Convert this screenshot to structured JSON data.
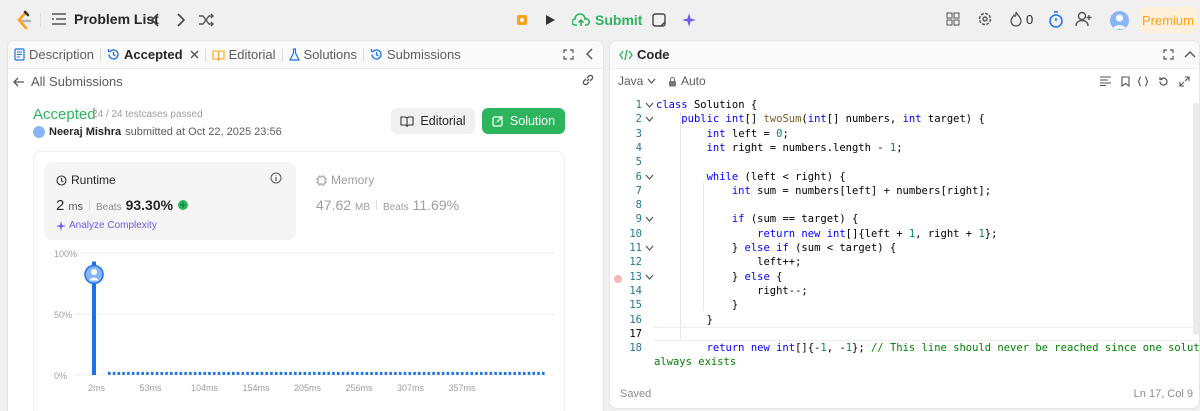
{
  "topbar": {
    "title": "Problem List",
    "submit_label": "Submit",
    "streak_count": "0",
    "premium_label": "Premium"
  },
  "left": {
    "tabs": [
      {
        "label": "Description"
      },
      {
        "label": "Accepted"
      },
      {
        "label": "Editorial"
      },
      {
        "label": "Solutions"
      },
      {
        "label": "Submissions"
      }
    ],
    "back_label": "All Submissions",
    "status": "Accepted",
    "testcases": "24 / 24 testcases passed",
    "user": "Neeraj Mishra",
    "submitted_at": "submitted at Oct 22, 2025 23:56",
    "editorial_btn": "Editorial",
    "solution_btn": "Solution",
    "runtime": {
      "label": "Runtime",
      "value": "2",
      "unit": "ms",
      "beats_label": "Beats",
      "beats": "93.30%"
    },
    "memory": {
      "label": "Memory",
      "value": "47.62",
      "unit": "MB",
      "beats_label": "Beats",
      "beats": "11.69%"
    },
    "analyze_label": "Analyze Complexity"
  },
  "chart_data": {
    "type": "bar",
    "title": "",
    "xlabel": "",
    "ylabel": "",
    "y_ticks": [
      "100%",
      "50%",
      "0%"
    ],
    "x_ticks": [
      "2ms",
      "53ms",
      "104ms",
      "154ms",
      "205ms",
      "256ms",
      "307ms",
      "357ms"
    ],
    "ylim": [
      0,
      100
    ],
    "highlight": {
      "x": "2ms",
      "value": 93
    },
    "baseline_value": 0.5,
    "color": "#1a73e8"
  },
  "right": {
    "title": "Code",
    "language": "Java",
    "mode": "Auto",
    "saved_label": "Saved",
    "cursor": "Ln 17, Col 9",
    "line_numbers": [
      "1",
      "2",
      "3",
      "4",
      "5",
      "6",
      "7",
      "8",
      "9",
      "10",
      "11",
      "12",
      "13",
      "14",
      "15",
      "16",
      "17",
      "18"
    ],
    "last_line_wrap": "always exists"
  },
  "colors": {
    "accent_green": "#2db55d",
    "submit_green": "#2db55d",
    "premium": "#ffa116",
    "blue": "#1a73e8"
  }
}
